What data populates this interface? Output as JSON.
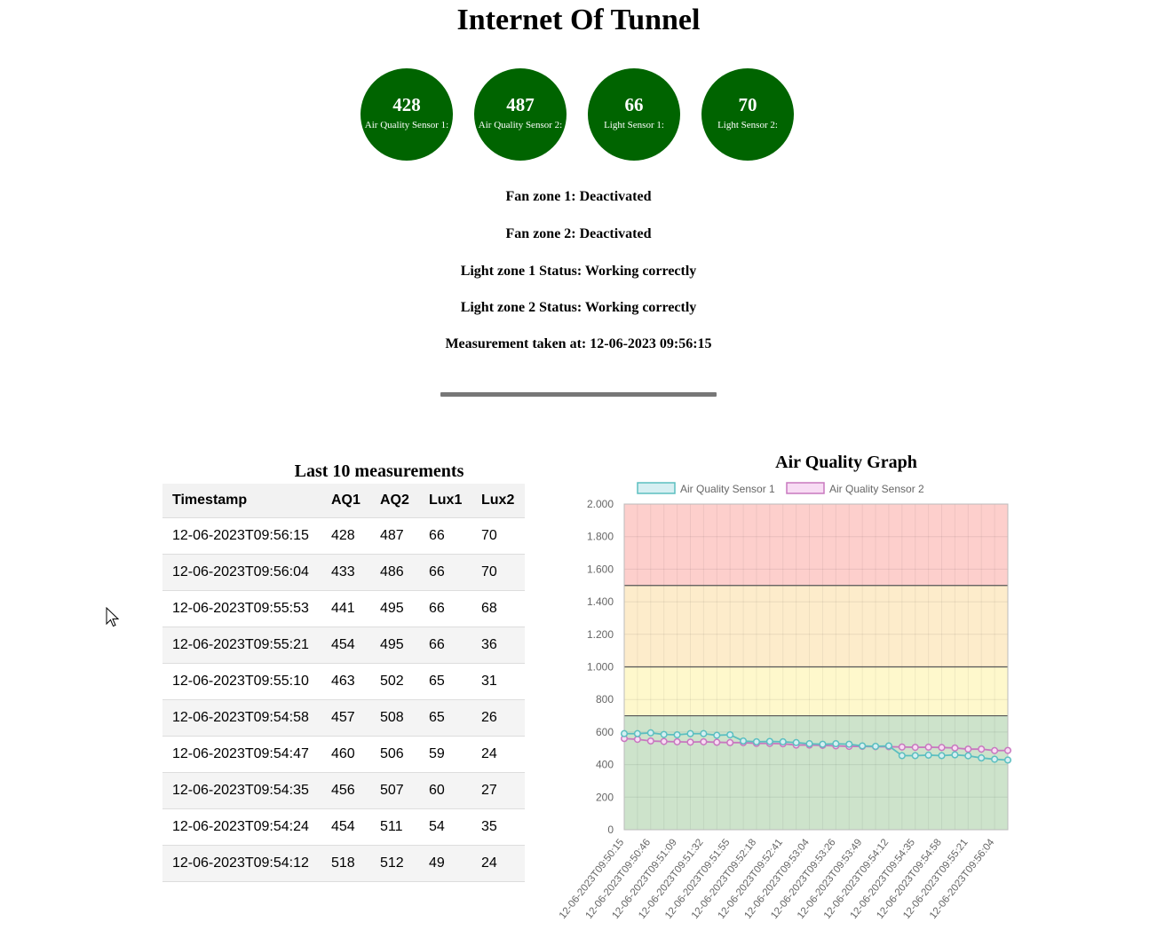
{
  "header": {
    "title": "Internet Of Tunnel"
  },
  "sensors": [
    {
      "value": "428",
      "label": "Air Quality Sensor 1:"
    },
    {
      "value": "487",
      "label": "Air Quality Sensor 2:"
    },
    {
      "value": "66",
      "label": "Light Sensor 1:"
    },
    {
      "value": "70",
      "label": "Light Sensor 2:"
    }
  ],
  "sensor_color": "#006400",
  "status": {
    "fan1": "Fan zone 1: Deactivated",
    "fan2": "Fan zone 2: Deactivated",
    "light1": "Light zone 1 Status: Working correctly",
    "light2": "Light zone 2 Status: Working correctly",
    "measured": "Measurement taken at: 12-06-2023 09:56:15"
  },
  "table": {
    "title": "Last 10 measurements",
    "headers": [
      "Timestamp",
      "AQ1",
      "AQ2",
      "Lux1",
      "Lux2"
    ],
    "rows": [
      [
        "12-06-2023T09:56:15",
        "428",
        "487",
        "66",
        "70"
      ],
      [
        "12-06-2023T09:56:04",
        "433",
        "486",
        "66",
        "70"
      ],
      [
        "12-06-2023T09:55:53",
        "441",
        "495",
        "66",
        "68"
      ],
      [
        "12-06-2023T09:55:21",
        "454",
        "495",
        "66",
        "36"
      ],
      [
        "12-06-2023T09:55:10",
        "463",
        "502",
        "65",
        "31"
      ],
      [
        "12-06-2023T09:54:58",
        "457",
        "508",
        "65",
        "26"
      ],
      [
        "12-06-2023T09:54:47",
        "460",
        "506",
        "59",
        "24"
      ],
      [
        "12-06-2023T09:54:35",
        "456",
        "507",
        "60",
        "27"
      ],
      [
        "12-06-2023T09:54:24",
        "454",
        "511",
        "54",
        "35"
      ],
      [
        "12-06-2023T09:54:12",
        "518",
        "512",
        "49",
        "24"
      ]
    ]
  },
  "chart_data": {
    "type": "line",
    "title": "Air Quality Graph",
    "legend_position": "top",
    "ylim": [
      0,
      2000
    ],
    "yticks": [
      "0",
      "200",
      "400",
      "600",
      "800",
      "1.000",
      "1.200",
      "1.400",
      "1.600",
      "1.800",
      "2.000"
    ],
    "xticks": [
      "12-06-2023T09:50:15",
      "12-06-2023T09:50:46",
      "12-06-2023T09:51:09",
      "12-06-2023T09:51:32",
      "12-06-2023T09:51:55",
      "12-06-2023T09:52:18",
      "12-06-2023T09:52:41",
      "12-06-2023T09:53:04",
      "12-06-2023T09:53:26",
      "12-06-2023T09:53:49",
      "12-06-2023T09:54:12",
      "12-06-2023T09:54:35",
      "12-06-2023T09:54:58",
      "12-06-2023T09:55:21",
      "12-06-2023T09:56:04"
    ],
    "bands": [
      {
        "from": 0,
        "to": 700,
        "color": "#cde3cb"
      },
      {
        "from": 700,
        "to": 1000,
        "color": "#fef8cc"
      },
      {
        "from": 1000,
        "to": 1500,
        "color": "#fdeccb"
      },
      {
        "from": 1500,
        "to": 2000,
        "color": "#fdcfcc"
      }
    ],
    "threshold_lines": [
      700,
      1000,
      1500
    ],
    "series": [
      {
        "name": "Air Quality Sensor 1",
        "color": "#5bbfc0",
        "fill": "#d6eff2",
        "values": [
          590,
          590,
          595,
          585,
          583,
          590,
          590,
          580,
          583,
          545,
          540,
          542,
          540,
          535,
          528,
          525,
          528,
          525,
          515,
          512,
          515,
          455,
          455,
          458,
          455,
          460,
          454,
          441,
          433,
          428
        ]
      },
      {
        "name": "Air Quality Sensor 2",
        "color": "#c878bf",
        "fill": "#f8dcf4",
        "values": [
          560,
          555,
          545,
          542,
          540,
          538,
          540,
          537,
          535,
          535,
          530,
          530,
          528,
          520,
          520,
          518,
          515,
          512,
          512,
          510,
          510,
          508,
          506,
          507,
          505,
          502,
          495,
          495,
          486,
          487
        ]
      }
    ]
  }
}
